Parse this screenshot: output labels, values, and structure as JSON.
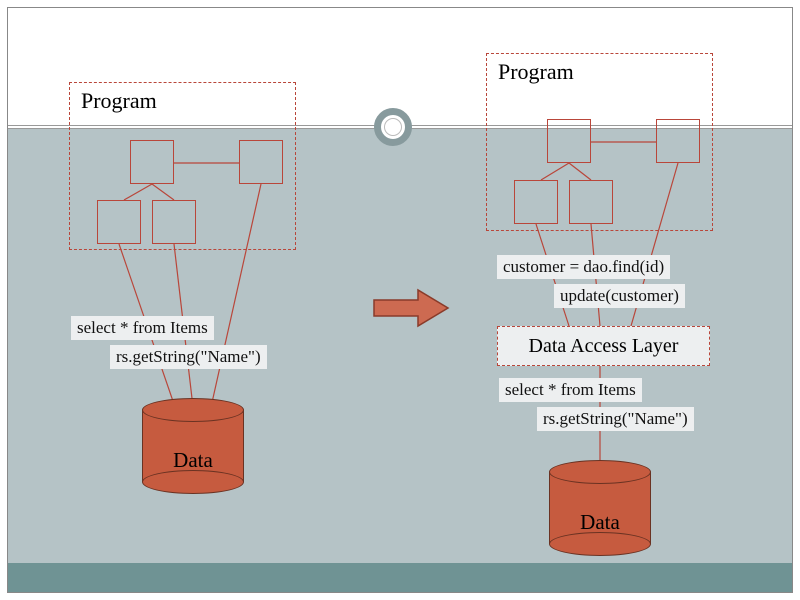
{
  "left": {
    "program_title": "Program",
    "labels": {
      "sql": "select * from Items",
      "rs": "rs.getString(\"Name\")"
    },
    "data_label": "Data"
  },
  "right": {
    "program_title": "Program",
    "labels": {
      "dao_find": "customer = dao.find(id)",
      "dao_update": "update(customer)",
      "sql": "select * from Items",
      "rs": "rs.getString(\"Name\")"
    },
    "dal_label": "Data Access Layer",
    "data_label": "Data"
  }
}
